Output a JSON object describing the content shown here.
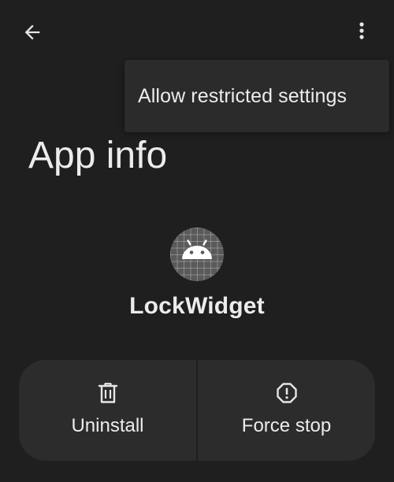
{
  "toolbar": {
    "back_icon": "arrow-back-icon",
    "overflow_icon": "more-vert-icon"
  },
  "overflow_menu": {
    "items": [
      {
        "label": "Allow restricted settings"
      }
    ]
  },
  "header": {
    "title": "App info"
  },
  "app": {
    "name": "LockWidget",
    "icon": "android-robot-icon"
  },
  "actions": [
    {
      "label": "Uninstall",
      "icon": "trash-icon"
    },
    {
      "label": "Force stop",
      "icon": "alert-octagon-icon"
    }
  ],
  "colors": {
    "background": "#1f1f1f",
    "surface": "#2c2c2c",
    "menu_surface": "#2b2b2b",
    "text": "#ececec"
  }
}
